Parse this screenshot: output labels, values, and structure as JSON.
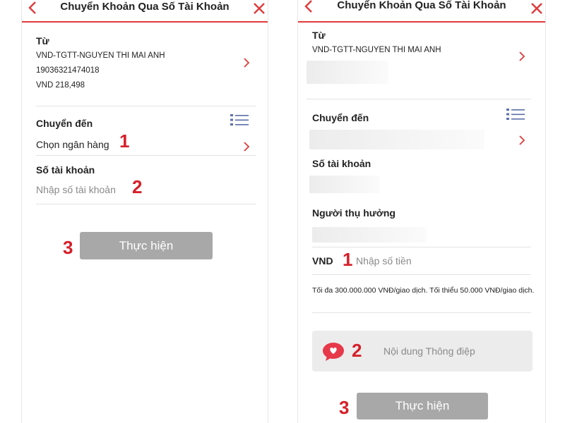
{
  "left": {
    "header": {
      "title": "Chuyển Khoản Qua Số Tài Khoản"
    },
    "from": {
      "label": "Từ",
      "account_name": "VND-TGTT-NGUYEN THI MAI ANH",
      "account_number": "19036321474018",
      "balance": "VND 218,498"
    },
    "transfer_to": {
      "label": "Chuyển đến",
      "value": "Chọn ngân hàng"
    },
    "account_no": {
      "label": "Số tài khoản",
      "placeholder": "Nhập số tài khoản"
    },
    "submit_label": "Thực hiện",
    "step_markers": [
      "1",
      "2",
      "3"
    ]
  },
  "right": {
    "header": {
      "title": "Chuyển Khoản Qua Số Tài Khoản"
    },
    "from": {
      "label": "Từ",
      "account_name": "VND-TGTT-NGUYEN THI MAI ANH"
    },
    "transfer_to": {
      "label": "Chuyển đến"
    },
    "account_no": {
      "label": "Số tài khoản"
    },
    "beneficiary": {
      "label": "Người thụ hưởng"
    },
    "amount": {
      "currency": "VND",
      "placeholder": "Nhập số tiền"
    },
    "limit_note": "Tối đa 300.000.000 VNĐ/giao dịch. Tối thiểu 50.000 VNĐ/giao dịch.",
    "message": {
      "placeholder": "Nội dung Thông điệp"
    },
    "submit_label": "Thực hiện",
    "step_markers": [
      "1",
      "2",
      "3"
    ]
  },
  "colors": {
    "accent": "#e03b3b",
    "step": "#d6202a",
    "button": "#a8a8a8",
    "list_icon": "#5a6ea8"
  },
  "icons": [
    "chevron-left-icon",
    "close-icon",
    "chevron-right-icon",
    "list-icon",
    "chat-heart-icon"
  ]
}
